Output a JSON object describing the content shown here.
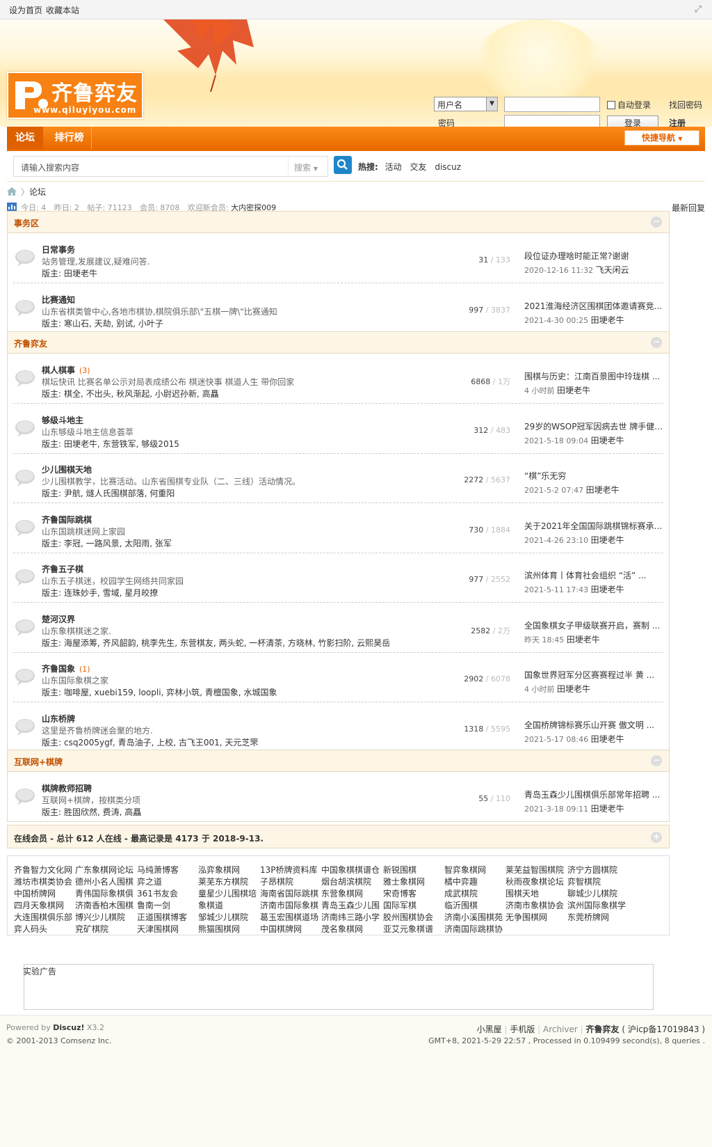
{
  "topbar": {
    "set_home": "设为首页",
    "bookmark": "收藏本站"
  },
  "logo": {
    "title": "齐鲁弈友",
    "url": "www.qiluyiyou.com"
  },
  "login": {
    "username_select": "用户名",
    "password_label": "密码",
    "auto_login": "自动登录",
    "login_button": "登录",
    "forgot_password": "找回密码",
    "register": "注册"
  },
  "nav": {
    "tabs": [
      {
        "label": "论坛"
      },
      {
        "label": "排行榜"
      }
    ],
    "quick_nav": "快捷导航"
  },
  "search": {
    "placeholder": "请输入搜索内容",
    "type": "搜索",
    "hot_label": "热搜:",
    "hot_terms": [
      "活动",
      "交友",
      "discuz"
    ]
  },
  "breadcrumb": {
    "item": "论坛"
  },
  "stats": {
    "today_label": "今日:",
    "today": "4",
    "yesterday_label": "昨日:",
    "yesterday": "2",
    "posts_label": "帖子:",
    "posts": "71123",
    "members_label": "会员:",
    "members": "8708",
    "welcome_label": "欢迎新会员:",
    "newest_member": "大内密探009",
    "latest_reply": "最新回复"
  },
  "sections": [
    {
      "title": "事务区",
      "forums": [
        {
          "name": "日常事务",
          "new": "",
          "desc": "站务管理,发展建议,疑难问答.",
          "mod_label": "版主:",
          "mods": "田埂老牛",
          "threads": "31",
          "posts": "133",
          "last_title": "段位证办理啥时能正常?谢谢",
          "last_time": "2020-12-16 11:32",
          "last_author": "飞天闲云"
        },
        {
          "name": "比赛通知",
          "new": "",
          "desc": "山东省棋类管中心,各地市棋协,棋院俱乐部\\\"五棋一牌\\\"比赛通知",
          "mod_label": "版主:",
          "mods": "寒山石, 天劫, 别试, 小叶子",
          "threads": "997",
          "posts": "3837",
          "last_title": "2021淮海经济区围棋团体邀请赛竞 ...",
          "last_time": "2021-4-30 00:25",
          "last_author": "田埂老牛"
        }
      ]
    },
    {
      "title": "齐鲁弈友",
      "forums": [
        {
          "name": "棋人棋事",
          "new": "(3)",
          "desc": "棋坛快讯 比赛名单公示对局表成绩公布 棋迷快事 棋道人生 带你回家",
          "mod_label": "版主:",
          "mods": "棋全, 不出头, 秋风渐起, 小尉迟孙新, 高矗",
          "threads": "6868",
          "posts": "1万",
          "last_title": "围棋与历史：江南百景图中玲珑棋 ...",
          "last_time": "4 小时前",
          "last_author": "田埂老牛"
        },
        {
          "name": "够级斗地主",
          "new": "",
          "desc": "山东够级斗地主信息荟萃",
          "mod_label": "版主:",
          "mods": "田埂老牛, 东营铁军, 够级2015",
          "threads": "312",
          "posts": "483",
          "last_title": "29岁的WSOP冠军因病去世 牌手健 ...",
          "last_time": "2021-5-18 09:04",
          "last_author": "田埂老牛"
        },
        {
          "name": "少儿围棋天地",
          "new": "",
          "desc": "少儿围棋教学，比赛活动。山东省围棋专业队（二、三线）活动情况。",
          "mod_label": "版主:",
          "mods": "尹航, 燧人氏围棋部落, 何重阳",
          "threads": "2272",
          "posts": "5637",
          "last_title": "“棋”乐无穷",
          "last_time": "2021-5-2 07:47",
          "last_author": "田埂老牛"
        },
        {
          "name": "齐鲁国际跳棋",
          "new": "",
          "desc": "山东国跳棋迷网上家园",
          "mod_label": "版主:",
          "mods": "李冠, 一路风景, 太阳雨, 张军",
          "threads": "730",
          "posts": "1884",
          "last_title": "关于2021年全国国际跳棋锦标赛承 ...",
          "last_time": "2021-4-26 23:10",
          "last_author": "田埂老牛"
        },
        {
          "name": "齐鲁五子棋",
          "new": "",
          "desc": "山东五子棋迷，校园学生网络共同家园",
          "mod_label": "版主:",
          "mods": "连珠妙手, 雪域, 星月皎撩",
          "threads": "977",
          "posts": "2552",
          "last_title": "滨州体育丨体育社会组织 “活” ...",
          "last_time": "2021-5-11 17:43",
          "last_author": "田埂老牛"
        },
        {
          "name": "楚河汉界",
          "new": "",
          "desc": "山东象棋棋迷之家.",
          "mod_label": "版主:",
          "mods": "海屋添筹, 齐风韶韵, 桃李先生, 东营棋友, 两头蛇, 一杯清茶, 方晓林, 竹影扫阶, 云熙昊岳",
          "threads": "2582",
          "posts": "2万",
          "last_title": "全国象棋女子甲级联赛开启，赛制 ...",
          "last_time": "昨天 18:45",
          "last_author": "田埂老牛"
        },
        {
          "name": "齐鲁国象",
          "new": "(1)",
          "desc": "山东国际象棋之家",
          "mod_label": "版主:",
          "mods": "咖啡屋, xuebi159, loopli, 弈林小筑, 青檀国象, 水城国象",
          "threads": "2902",
          "posts": "6078",
          "last_title": "国象世界冠军分区赛赛程过半 黄 ...",
          "last_time": "4 小时前",
          "last_author": "田埂老牛"
        },
        {
          "name": "山东桥牌",
          "new": "",
          "desc": "这里是齐鲁桥牌迷会聚的地方.",
          "mod_label": "版主:",
          "mods": "csq2005ygf, 青岛油子, 上校, 古飞王001, 天元芝罘",
          "threads": "1318",
          "posts": "5595",
          "last_title": "全国桥牌锦标赛乐山开赛 傲文明 ...",
          "last_time": "2021-5-17 08:46",
          "last_author": "田埂老牛"
        }
      ]
    },
    {
      "title": "互联网+棋牌",
      "forums": [
        {
          "name": "棋牌教师招聘",
          "new": "",
          "desc": "互联网+棋牌，按棋类分项",
          "mod_label": "版主:",
          "mods": "胜固欣然, 费涛, 高矗",
          "threads": "55",
          "posts": "110",
          "last_title": "青岛玉森少儿围棋俱乐部常年招聘 ...",
          "last_time": "2021-3-18 09:11",
          "last_author": "田埂老牛"
        }
      ]
    }
  ],
  "online": {
    "text": "在线会员 - 总计 612 人在线 - 最高记录是 4173 于 2018-9-13."
  },
  "links": [
    "齐鲁智力文化网",
    "广东象棋网论坛",
    "马纯萧博客",
    "泓弈象棋网",
    "13P桥牌资料库",
    "中国象棋棋谱仓",
    "新锐围棋",
    "智弈象棋网",
    "莱芜益智围棋院",
    "济宁方圆棋院",
    "潍坊市棋类协会",
    "德州小名人围棋",
    "弈之道",
    "莱芜东方棋院",
    "子昂棋院",
    "烟台胡滨棋院",
    "雅士象棋网",
    "橘中弈趣",
    "秋雨夜象棋论坛",
    "弈智棋院",
    "中国桥牌网",
    "青伟国际象棋俱",
    "361书友会",
    "童星少儿围棋培",
    "海南省国际跳棋",
    "东营象棋网",
    "宋奇博客",
    "成武棋院",
    "围棋天地",
    "聊城少儿棋院",
    "四月天象棋网",
    "济南香柏木围棋",
    "鲁南一剑",
    "象棋道",
    "济南市国际象棋",
    "青岛玉森少儿围",
    "国际军棋",
    "临沂围棋",
    "济南市象棋协会",
    "滨州国际象棋学",
    "大连围棋俱乐部",
    "博兴少儿棋院",
    "正道围棋博客",
    "邹城少儿棋院",
    "葛玉宏围棋道场",
    "济南纬三路小学",
    "胶州围棋协会",
    "济南小溪围棋苑",
    "无争围棋网",
    "东莞桥牌网",
    "弈人码头",
    "兖矿棋院",
    "天津围棋网",
    "熊猫围棋网",
    "中国棋牌网",
    "茂名象棋网",
    "亚艾元象棋谱",
    "济南国际跳棋协"
  ],
  "ad": {
    "text": "实验广告"
  },
  "footer": {
    "powered_by": "Powered by",
    "brand": "Discuz!",
    "version": "X3.2",
    "copyright": "© 2001-2013 Comsenz Inc.",
    "links": [
      "小黑屋",
      "手机版",
      "Archiver",
      "齐鲁弈友",
      "( 沪icp备17019843 )"
    ],
    "gmt": "GMT+8, 2021-5-29 22:57 , Processed in 0.109499 second(s), 8 queries ."
  },
  "colors": {
    "accent": "#f78112",
    "nav": "#ea6b00",
    "section_title": "#c05000",
    "search_button": "#1e86c9"
  },
  "icons": [
    "expand-icon",
    "home-icon",
    "stats-icon",
    "forum-bubble-icon",
    "collapse-icon",
    "search-icon",
    "chevron-down-icon"
  ]
}
